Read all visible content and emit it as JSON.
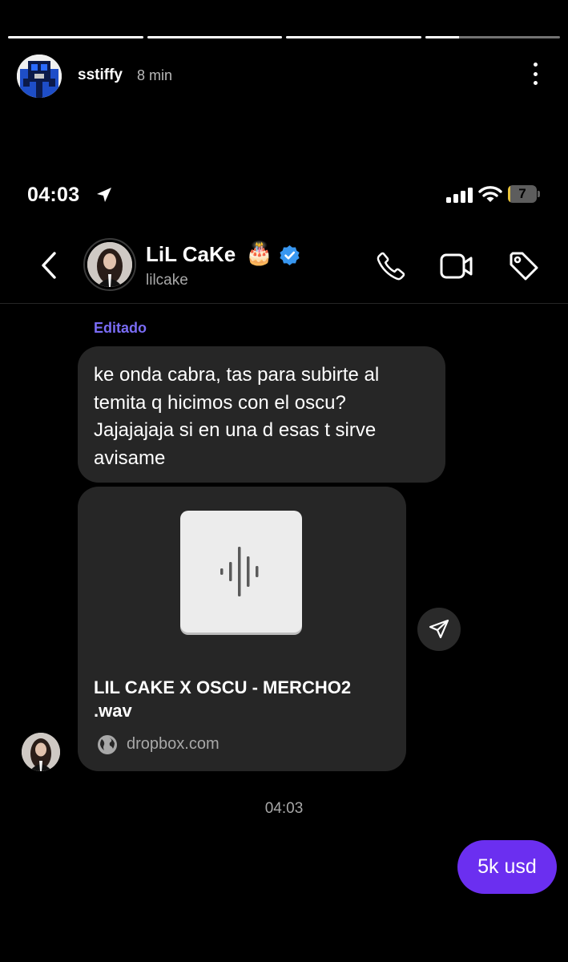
{
  "story": {
    "username": "sstiffy",
    "time": "8 min",
    "progress": [
      1,
      1,
      1,
      0.25
    ]
  },
  "status_bar": {
    "time": "04:03",
    "battery": "7"
  },
  "chat_header": {
    "name": "LiL CaKe",
    "emoji": "🎂",
    "handle": "lilcake",
    "verified": true
  },
  "messages": {
    "edited_label": "Editado",
    "text": "ke onda cabra, tas para subirte al temita q hicimos con el oscu? Jajajajaja si en una d esas t sirve avisame",
    "link": {
      "title": "LIL CAKE X OSCU - MERCHO2 .wav",
      "domain": "dropbox.com"
    },
    "timestamp": "04:03",
    "sent": "5k usd"
  },
  "colors": {
    "accent_edited": "#7a6cf5",
    "sent_bubble": "#6b2ff0",
    "received_bubble": "#262626",
    "verified": "#3897f0"
  },
  "icons": [
    "more-icon",
    "location-arrow-icon",
    "signal-icon",
    "wifi-icon",
    "battery-icon",
    "back-icon",
    "verified-icon",
    "phone-icon",
    "video-icon",
    "tag-icon",
    "audio-waveform-icon",
    "globe-icon",
    "share-icon"
  ]
}
